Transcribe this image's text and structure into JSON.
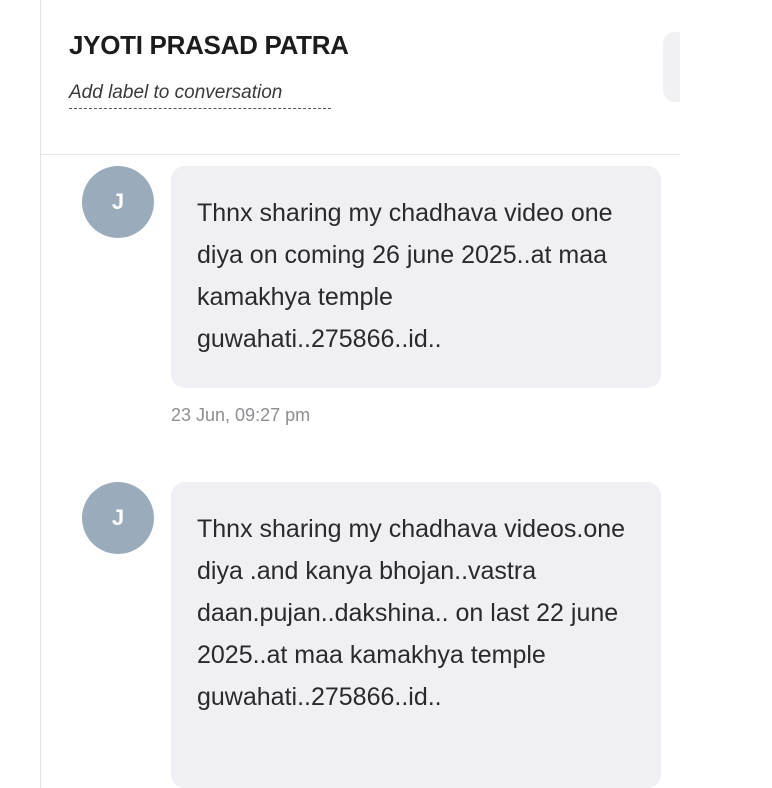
{
  "conversation": {
    "contact_name": "JYOTI PRASAD PATRA",
    "add_label_text": "Add label to conversation"
  },
  "messages": [
    {
      "avatar_initial": "J",
      "text": "Thnx sharing my chadhava video one diya on coming 26 june 2025..at maa kamakhya temple guwahati..275866..id..",
      "timestamp": "23 Jun, 09:27 pm"
    },
    {
      "avatar_initial": "J",
      "text": "Thnx sharing my chadhava videos.one diya .and kanya bhojan..vastra daan.pujan..dakshina.. on last 22 june 2025..at maa kamakhya temple guwahati..275866..id.."
    }
  ],
  "colors": {
    "avatar_bg": "#9aacbc",
    "bubble_bg": "#f0f0f4",
    "timestamp_text": "#8e8e93"
  }
}
